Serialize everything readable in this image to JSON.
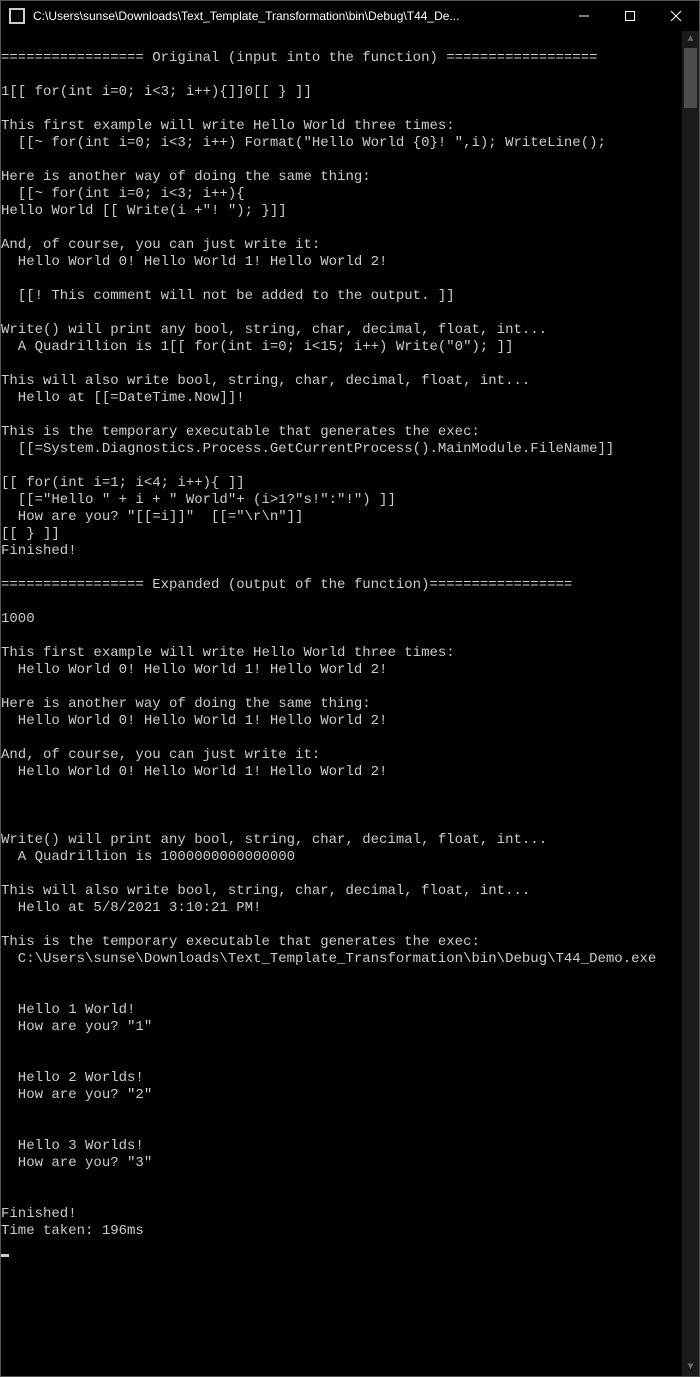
{
  "window": {
    "title": "C:\\Users\\sunse\\Downloads\\Text_Template_Transformation\\bin\\Debug\\T44_De..."
  },
  "console": {
    "lines": [
      "",
      "================= Original (input into the function) ==================",
      "",
      "1[[ for(int i=0; i<3; i++){]]0[[ } ]]",
      "",
      "This first example will write Hello World three times:",
      "  [[~ for(int i=0; i<3; i++) Format(\"Hello World {0}! \",i); WriteLine();",
      "",
      "Here is another way of doing the same thing:",
      "  [[~ for(int i=0; i<3; i++){",
      "Hello World [[ Write(i +\"! \"); }]]",
      "",
      "And, of course, you can just write it:",
      "  Hello World 0! Hello World 1! Hello World 2!",
      "",
      "  [[! This comment will not be added to the output. ]]",
      "",
      "Write() will print any bool, string, char, decimal, float, int...",
      "  A Quadrillion is 1[[ for(int i=0; i<15; i++) Write(\"0\"); ]]",
      "",
      "This will also write bool, string, char, decimal, float, int...",
      "  Hello at [[=DateTime.Now]]!",
      "",
      "This is the temporary executable that generates the exec:",
      "  [[=System.Diagnostics.Process.GetCurrentProcess().MainModule.FileName]]",
      "",
      "[[ for(int i=1; i<4; i++){ ]]",
      "  [[=\"Hello \" + i + \" World\"+ (i>1?\"s!\":\"!\") ]]",
      "  How are you? \"[[=i]]\"  [[=\"\\r\\n\"]]",
      "[[ } ]]",
      "Finished!",
      "",
      "================= Expanded (output of the function)=================",
      "",
      "1000",
      "",
      "This first example will write Hello World three times:",
      "  Hello World 0! Hello World 1! Hello World 2!",
      "",
      "Here is another way of doing the same thing:",
      "  Hello World 0! Hello World 1! Hello World 2!",
      "",
      "And, of course, you can just write it:",
      "  Hello World 0! Hello World 1! Hello World 2!",
      "",
      "",
      "",
      "Write() will print any bool, string, char, decimal, float, int...",
      "  A Quadrillion is 1000000000000000",
      "",
      "This will also write bool, string, char, decimal, float, int...",
      "  Hello at 5/8/2021 3:10:21 PM!",
      "",
      "This is the temporary executable that generates the exec:",
      "  C:\\Users\\sunse\\Downloads\\Text_Template_Transformation\\bin\\Debug\\T44_Demo.exe",
      "",
      "",
      "  Hello 1 World!",
      "  How are you? \"1\"",
      "",
      "",
      "  Hello 2 Worlds!",
      "  How are you? \"2\"",
      "",
      "",
      "  Hello 3 Worlds!",
      "  How are you? \"3\"",
      "",
      "",
      "Finished!",
      "Time taken: 196ms"
    ]
  }
}
